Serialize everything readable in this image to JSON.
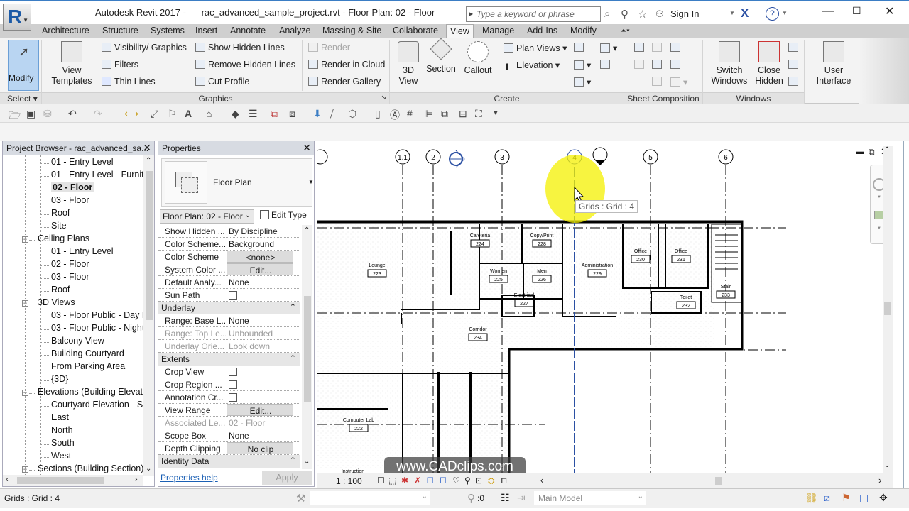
{
  "titlebar": {
    "app_name": "Autodesk Revit 2017 -",
    "document": "rac_advanced_sample_project.rvt - Floor Plan: 02 - Floor",
    "search_placeholder": "Type a keyword or phrase",
    "sign_in": "Sign In",
    "help": "?"
  },
  "tabs": [
    "Architecture",
    "Structure",
    "Systems",
    "Insert",
    "Annotate",
    "Analyze",
    "Massing & Site",
    "Collaborate",
    "View",
    "Manage",
    "Add-Ins",
    "Modify"
  ],
  "active_tab": "View",
  "ribbon": {
    "select": {
      "modify": "Modify",
      "title": "Select"
    },
    "graphics": {
      "title": "Graphics",
      "view_templates": "View Templates",
      "visibility_graphics": "Visibility/ Graphics",
      "filters": "Filters",
      "thin_lines": "Thin Lines",
      "show_hidden_lines": "Show Hidden Lines",
      "remove_hidden_lines": "Remove Hidden Lines",
      "cut_profile": "Cut Profile",
      "render": "Render",
      "render_in_cloud": "Render in Cloud",
      "render_gallery": "Render Gallery"
    },
    "create": {
      "title": "Create",
      "view_3d": "3D View",
      "section": "Section",
      "callout": "Callout",
      "plan_views": "Plan Views",
      "elevation": "Elevation"
    },
    "sheet_composition": {
      "title": "Sheet Composition"
    },
    "windows": {
      "title": "Windows",
      "switch_windows": "Switch Windows",
      "close_hidden": "Close Hidden"
    },
    "user_interface": "User Interface"
  },
  "project_browser": {
    "title": "Project Browser - rac_advanced_sa...",
    "items": [
      {
        "label": "01 - Entry Level",
        "level": 2
      },
      {
        "label": "01 - Entry Level - Furnitu",
        "level": 2
      },
      {
        "label": "02 - Floor",
        "level": 2,
        "selected": true
      },
      {
        "label": "03 - Floor",
        "level": 2
      },
      {
        "label": "Roof",
        "level": 2
      },
      {
        "label": "Site",
        "level": 2
      },
      {
        "label": "Ceiling Plans",
        "level": 1,
        "expanded": true
      },
      {
        "label": "01 - Entry Level",
        "level": 2
      },
      {
        "label": "02 - Floor",
        "level": 2
      },
      {
        "label": "03 - Floor",
        "level": 2
      },
      {
        "label": "Roof",
        "level": 2
      },
      {
        "label": "3D Views",
        "level": 1,
        "expanded": true
      },
      {
        "label": "03 - Floor Public - Day R",
        "level": 2
      },
      {
        "label": "03 - Floor Public - Night",
        "level": 2
      },
      {
        "label": "Balcony View",
        "level": 2
      },
      {
        "label": "Building Courtyard",
        "level": 2
      },
      {
        "label": "From Parking Area",
        "level": 2
      },
      {
        "label": "{3D}",
        "level": 2
      },
      {
        "label": "Elevations (Building Elevatio",
        "level": 1,
        "expanded": true
      },
      {
        "label": "Courtyard Elevation - So",
        "level": 2
      },
      {
        "label": "East",
        "level": 2
      },
      {
        "label": "North",
        "level": 2
      },
      {
        "label": "South",
        "level": 2
      },
      {
        "label": "West",
        "level": 2
      },
      {
        "label": "Sections (Building Section)",
        "level": 1,
        "expanded": true
      }
    ]
  },
  "properties": {
    "title": "Properties",
    "type_name": "Floor Plan",
    "instance_selector": "Floor Plan: 02 - Floor",
    "edit_type": "Edit Type",
    "rows": [
      {
        "key": "Show Hidden ...",
        "value": "By Discipline"
      },
      {
        "key": "Color Scheme...",
        "value": "Background"
      },
      {
        "key": "Color Scheme",
        "value": "<none>",
        "button": true
      },
      {
        "key": "System Color ...",
        "value": "Edit...",
        "button": true
      },
      {
        "key": "Default Analy...",
        "value": "None"
      },
      {
        "key": "Sun Path",
        "checkbox": false
      },
      {
        "section": "Underlay"
      },
      {
        "key": "Range: Base L...",
        "value": "None"
      },
      {
        "key": "Range: Top Le...",
        "value": "Unbounded",
        "dim": true
      },
      {
        "key": "Underlay Orie...",
        "value": "Look down",
        "dim": true
      },
      {
        "section": "Extents"
      },
      {
        "key": "Crop View",
        "checkbox": false
      },
      {
        "key": "Crop Region ...",
        "checkbox": false
      },
      {
        "key": "Annotation Cr...",
        "checkbox": false
      },
      {
        "key": "View Range",
        "value": "Edit...",
        "button": true
      },
      {
        "key": "Associated Le...",
        "value": "02 - Floor",
        "dim": true
      },
      {
        "key": "Scope Box",
        "value": "None"
      },
      {
        "key": "Depth Clipping",
        "value": "No clip",
        "button": true
      },
      {
        "section": "Identity Data"
      }
    ],
    "help_link": "Properties help",
    "apply": "Apply"
  },
  "canvas": {
    "grid_labels": [
      "1.1",
      "2",
      "3",
      "4",
      "5",
      "6"
    ],
    "tooltip": "Grids : Grid : 4",
    "rooms": [
      {
        "name": "Lounge",
        "number": "223"
      },
      {
        "name": "Cafeteria",
        "number": "224"
      },
      {
        "name": "Copy/Print",
        "number": "228"
      },
      {
        "name": "Women",
        "number": "225"
      },
      {
        "name": "Men",
        "number": "226"
      },
      {
        "name": "Electrical",
        "number": "227"
      },
      {
        "name": "Administration",
        "number": "229"
      },
      {
        "name": "Office",
        "number": "230"
      },
      {
        "name": "Office",
        "number": "231"
      },
      {
        "name": "Toilet",
        "number": "232"
      },
      {
        "name": "Stair",
        "number": "233"
      },
      {
        "name": "Corridor",
        "number": "234"
      },
      {
        "name": "Computer Lab",
        "number": "222"
      },
      {
        "name": "Instruction",
        "number": ""
      }
    ],
    "watermark": "www.CADclips.com"
  },
  "view_control_bar": {
    "scale": "1 : 100"
  },
  "status_bar": {
    "message": "Grids : Grid : 4",
    "worksets_count": ":0",
    "design_option": "Main Model"
  }
}
